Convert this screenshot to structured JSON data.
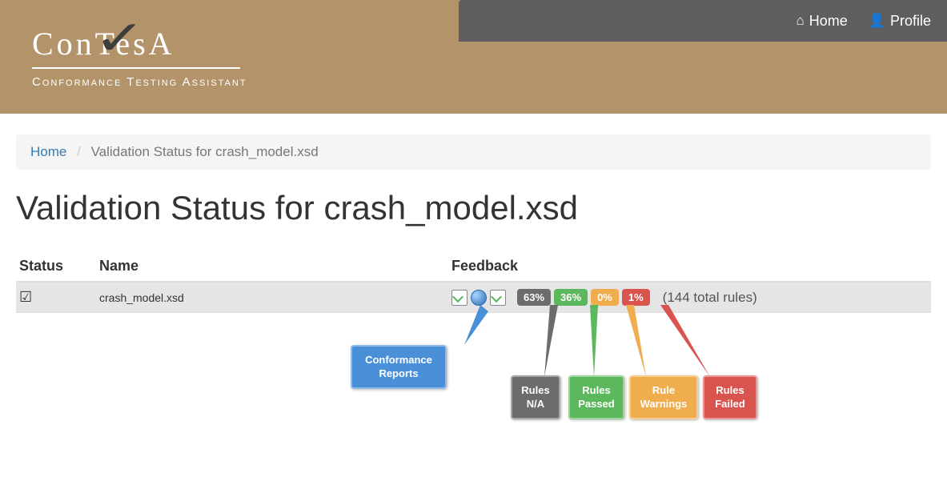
{
  "header": {
    "logo_main": "ConTesA",
    "logo_sub": "Conformance Testing Assistant",
    "nav": {
      "home": "Home",
      "profile": "Profile"
    }
  },
  "breadcrumb": {
    "home": "Home",
    "current": "Validation Status for crash_model.xsd"
  },
  "page_title": "Validation Status for crash_model.xsd",
  "table": {
    "headers": {
      "status": "Status",
      "name": "Name",
      "feedback": "Feedback"
    },
    "row": {
      "name": "crash_model.xsd",
      "badges": {
        "na": "63%",
        "passed": "36%",
        "warning": "0%",
        "failed": "1%"
      },
      "total": "(144 total rules)"
    }
  },
  "annotations": {
    "reports": "Conformance Reports",
    "na": "Rules N/A",
    "passed": "Rules Passed",
    "warning": "Rule Warnings",
    "failed": "Rules Failed"
  }
}
